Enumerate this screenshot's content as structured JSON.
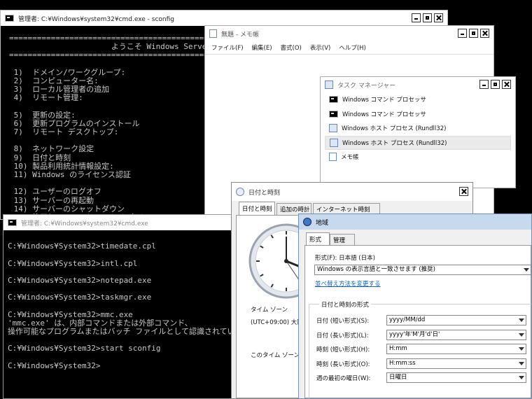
{
  "cmd_sconfig": {
    "title": "管理者: C:¥Windows¥system32¥cmd.exe - sconfig",
    "lines": [
      "=======================================================================",
      "                      ようこそ Windows Server",
      "=======================================================================",
      "",
      " 1)  ドメイン/ワークグループ:",
      " 2)  コンピューター名:",
      " 3)  ローカル管理者の追加",
      " 4)  リモート管理:",
      "",
      " 5)  更新の設定:",
      " 6)  更新プログラムのインストール",
      " 7)  リモート デスクトップ:",
      "",
      " 8)  ネットワーク設定",
      " 9)  日付と時刻",
      " 10) 製品利用統計情報設定:",
      " 11) Windows のライセンス認証",
      "",
      " 12) ユーザーのログオフ",
      " 13) サーバーの再起動",
      " 14) サーバーのシャットダウン",
      " 15) 終了してコマンド ラインに戻る (PowerShe"
    ]
  },
  "notepad": {
    "title": "無題 - メモ帳",
    "menu": [
      "ファイル(F)",
      "編集(E)",
      "書式(O)",
      "表示(V)",
      "ヘルプ(H)"
    ]
  },
  "taskmgr": {
    "title": "タスク マネージャー",
    "rows": [
      {
        "label": "Windows コマンド プロセッサ",
        "icon": "cmd-icon"
      },
      {
        "label": "Windows コマンド プロセッサ",
        "icon": "cmd-icon"
      },
      {
        "label": "Windows ホスト プロセス (Rundll32)",
        "icon": "app-icon"
      },
      {
        "label": "Windows ホスト プロセス (Rundll32)",
        "icon": "app-icon"
      },
      {
        "label": "メモ帳",
        "icon": "notepad-icon"
      }
    ]
  },
  "cmd2": {
    "title": "管理者: C:¥Windows¥system32¥cmd.exe",
    "lines": [
      "",
      "C:¥Windows¥System32>timedate.cpl",
      "",
      "C:¥Windows¥System32>intl.cpl",
      "",
      "C:¥Windows¥System32>notepad.exe",
      "",
      "C:¥Windows¥System32>taskmgr.exe",
      "",
      "C:¥Windows¥System32>mmc.exe",
      "'mmc.exe' は、内部コマンドまたは外部コマンド、",
      "操作可能なプログラムまたはバッチ ファイルとして認識されていません。",
      "",
      "C:¥Windows¥System32>start sconfig",
      "",
      "C:¥Windows¥System32>"
    ]
  },
  "datetime": {
    "title": "日付と時刻",
    "tabs": [
      "日付と時刻",
      "追加の時計",
      "インターネット時刻"
    ],
    "timezone_label": "タイム ゾーン",
    "timezone_value": "(UTC+09:00) 大阪、",
    "dst_text": "このタイム ゾーンでは"
  },
  "region": {
    "title": "地域",
    "tabs": [
      "形式",
      "管理"
    ],
    "format_label": "形式(F): 日本語 (日本)",
    "format_value": "Windows の表示言語と一致させます (推奨)",
    "sort_link": "並べ替え方法を変更する",
    "group_title": "日付と時刻の形式",
    "fields": [
      {
        "label": "日付 (短い形式)(S):",
        "value": "yyyy/MM/dd"
      },
      {
        "label": "日付 (長い形式)(L):",
        "value": "yyyy'年'M'月'd'日'"
      },
      {
        "label": "時刻 (短い形式)(H):",
        "value": "H:mm"
      },
      {
        "label": "時刻 (長い形式)(O):",
        "value": "H:mm:ss"
      },
      {
        "label": "週の最初の曜日(W):",
        "value": "日曜日"
      }
    ]
  }
}
